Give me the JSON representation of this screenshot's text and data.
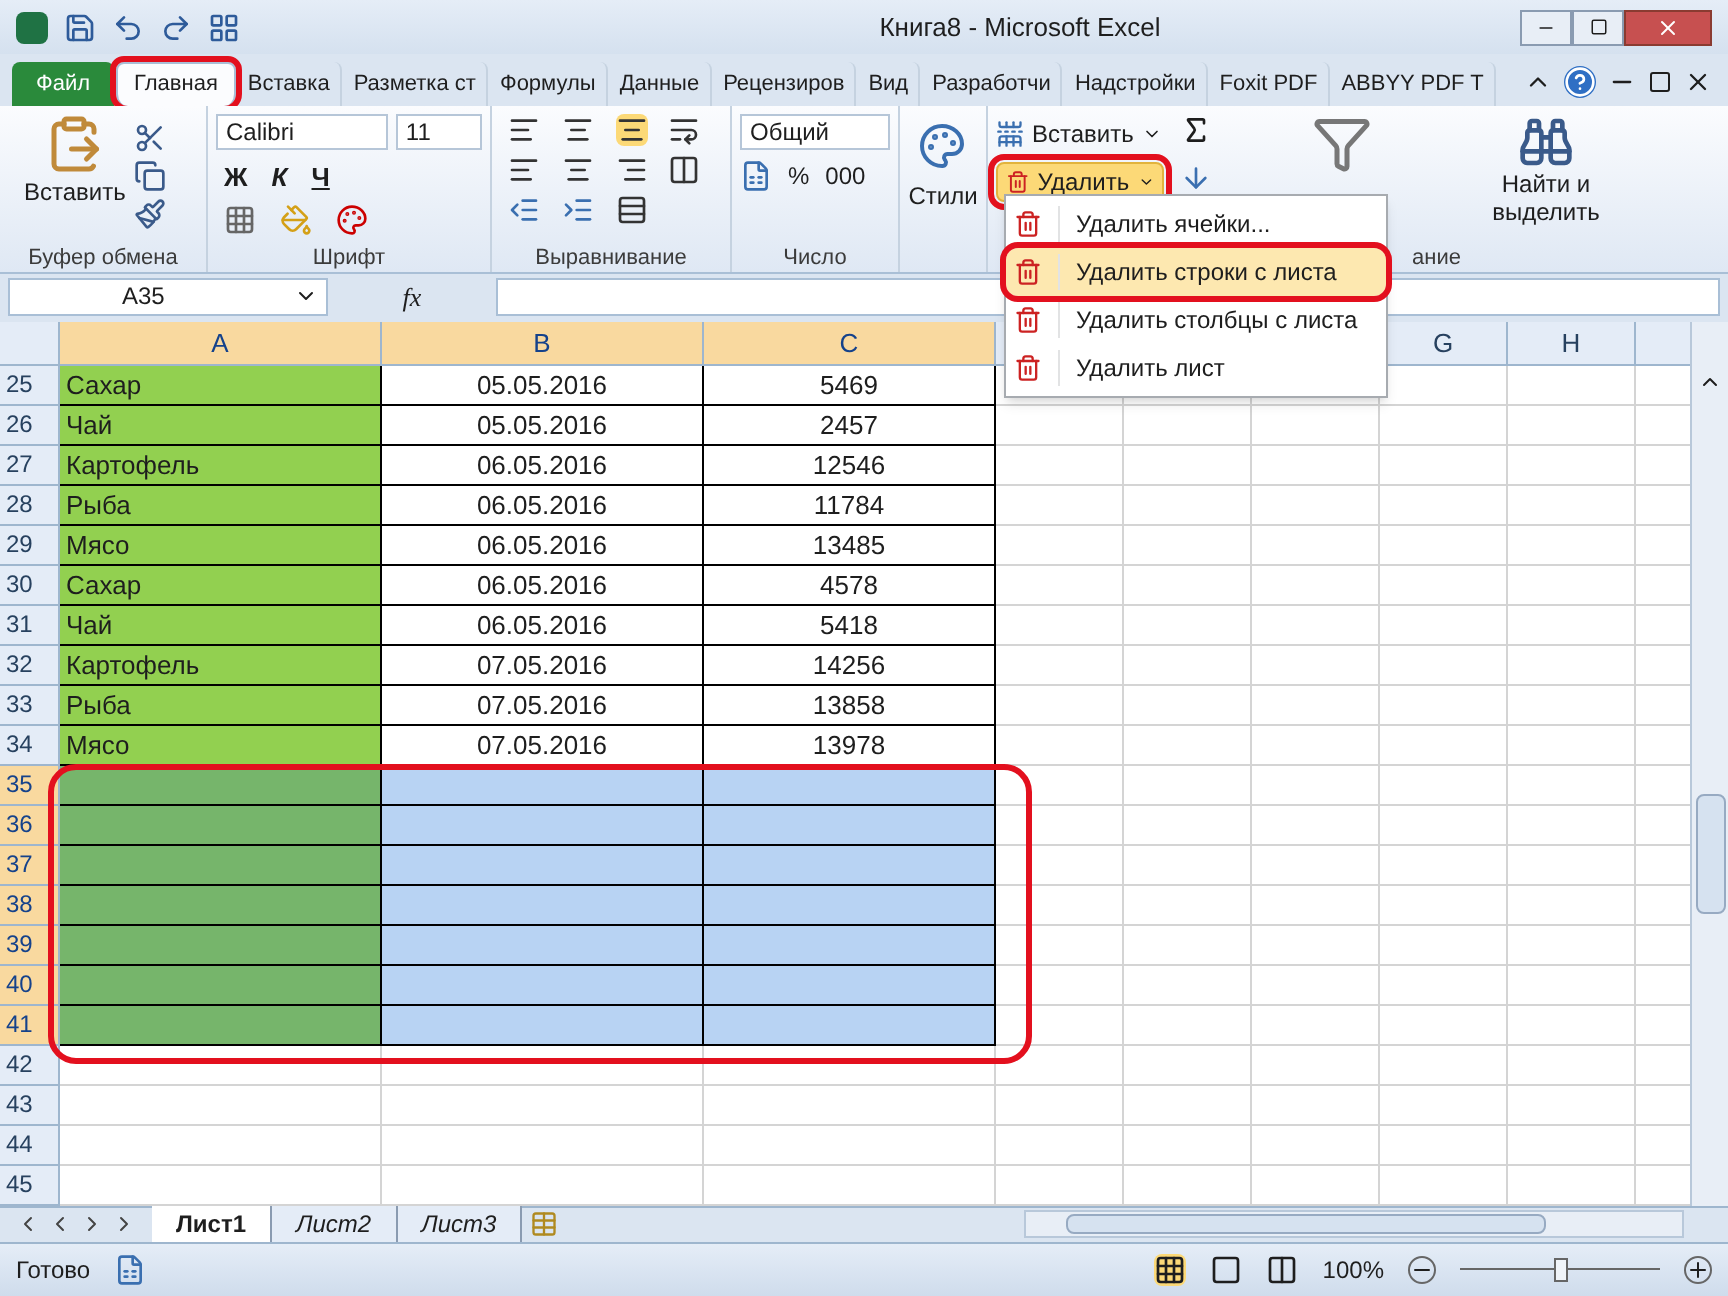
{
  "window": {
    "title": "Книга8 - Microsoft Excel"
  },
  "ribbon_tabs": [
    {
      "label": "Файл",
      "kind": "file",
      "selected": false,
      "circled": false
    },
    {
      "label": "Главная",
      "kind": "tab",
      "selected": true,
      "circled": true
    },
    {
      "label": "Вставка",
      "kind": "tab",
      "selected": false,
      "circled": false
    },
    {
      "label": "Разметка ст",
      "kind": "tab",
      "selected": false,
      "circled": false
    },
    {
      "label": "Формулы",
      "kind": "tab",
      "selected": false,
      "circled": false
    },
    {
      "label": "Данные",
      "kind": "tab",
      "selected": false,
      "circled": false
    },
    {
      "label": "Рецензиров",
      "kind": "tab",
      "selected": false,
      "circled": false
    },
    {
      "label": "Вид",
      "kind": "tab",
      "selected": false,
      "circled": false
    },
    {
      "label": "Разработчи",
      "kind": "tab",
      "selected": false,
      "circled": false
    },
    {
      "label": "Надстройки",
      "kind": "tab",
      "selected": false,
      "circled": false
    },
    {
      "label": "Foxit PDF",
      "kind": "tab",
      "selected": false,
      "circled": false
    },
    {
      "label": "ABBYY PDF T",
      "kind": "tab",
      "selected": false,
      "circled": false
    }
  ],
  "ribbon": {
    "clipboard": {
      "paste": "Вставить",
      "group_label": "Буфер обмена"
    },
    "font": {
      "name": "Calibri",
      "size": "11",
      "bold": "Ж",
      "italic": "К",
      "underline": "Ч",
      "group_label": "Шрифт"
    },
    "alignment": {
      "group_label": "Выравнивание"
    },
    "number": {
      "format": "Общий",
      "percent": "%",
      "thousands": "000",
      "group_label": "Число"
    },
    "styles": {
      "label": "Стили"
    },
    "cells": {
      "insert": "Вставить",
      "delete": "Удалить",
      "delete_circled": true
    },
    "editing": {
      "find": "Найти и выделить",
      "group_label": "ание"
    }
  },
  "delete_menu": [
    {
      "label": "Удалить ячейки...",
      "selected": false,
      "circled": false
    },
    {
      "label": "Удалить строки с листа",
      "selected": true,
      "circled": true
    },
    {
      "label": "Удалить столбцы с листа",
      "selected": false,
      "circled": false
    },
    {
      "label": "Удалить лист",
      "selected": false,
      "circled": false
    }
  ],
  "formula_bar": {
    "name_box": "A35",
    "fx": "fx"
  },
  "columns": [
    {
      "label": "A",
      "selected": true
    },
    {
      "label": "B",
      "selected": true
    },
    {
      "label": "C",
      "selected": true
    },
    {
      "label": "G",
      "selected": false
    },
    {
      "label": "H",
      "selected": false
    }
  ],
  "selection_circled": true,
  "rows": [
    {
      "number": "25",
      "selected": false,
      "highlighted": true,
      "cells": [
        "Сахар",
        "05.05.2016",
        "5469"
      ]
    },
    {
      "number": "26",
      "selected": false,
      "highlighted": true,
      "cells": [
        "Чай",
        "05.05.2016",
        "2457"
      ]
    },
    {
      "number": "27",
      "selected": false,
      "highlighted": true,
      "cells": [
        "Картофель",
        "06.05.2016",
        "12546"
      ]
    },
    {
      "number": "28",
      "selected": false,
      "highlighted": true,
      "cells": [
        "Рыба",
        "06.05.2016",
        "11784"
      ]
    },
    {
      "number": "29",
      "selected": false,
      "highlighted": true,
      "cells": [
        "Мясо",
        "06.05.2016",
        "13485"
      ]
    },
    {
      "number": "30",
      "selected": false,
      "highlighted": true,
      "cells": [
        "Сахар",
        "06.05.2016",
        "4578"
      ]
    },
    {
      "number": "31",
      "selected": false,
      "highlighted": true,
      "cells": [
        "Чай",
        "06.05.2016",
        "5418"
      ]
    },
    {
      "number": "32",
      "selected": false,
      "highlighted": true,
      "cells": [
        "Картофель",
        "07.05.2016",
        "14256"
      ]
    },
    {
      "number": "33",
      "selected": false,
      "highlighted": true,
      "cells": [
        "Рыба",
        "07.05.2016",
        "13858"
      ]
    },
    {
      "number": "34",
      "selected": false,
      "highlighted": true,
      "cells": [
        "Мясо",
        "07.05.2016",
        "13978"
      ]
    },
    {
      "number": "35",
      "selected": true,
      "highlighted": true
    },
    {
      "number": "36",
      "selected": true,
      "highlighted": true
    },
    {
      "number": "37",
      "selected": true,
      "highlighted": true
    },
    {
      "number": "38",
      "selected": true,
      "highlighted": true
    },
    {
      "number": "39",
      "selected": true,
      "highlighted": true
    },
    {
      "number": "40",
      "selected": true,
      "highlighted": true
    },
    {
      "number": "41",
      "selected": true,
      "highlighted": true
    },
    {
      "number": "42",
      "selected": false,
      "highlighted": false
    },
    {
      "number": "43",
      "selected": false,
      "highlighted": false
    },
    {
      "number": "44",
      "selected": false,
      "highlighted": false
    },
    {
      "number": "45",
      "selected": false,
      "highlighted": false
    }
  ],
  "sheet_tabs": [
    {
      "label": "Лист1",
      "selected": true
    },
    {
      "label": "Лист2",
      "selected": false
    },
    {
      "label": "Лист3",
      "selected": false
    }
  ],
  "status": {
    "text": "Готово",
    "zoom": "100%",
    "zoom_slider": {
      "level": 0.5
    }
  }
}
